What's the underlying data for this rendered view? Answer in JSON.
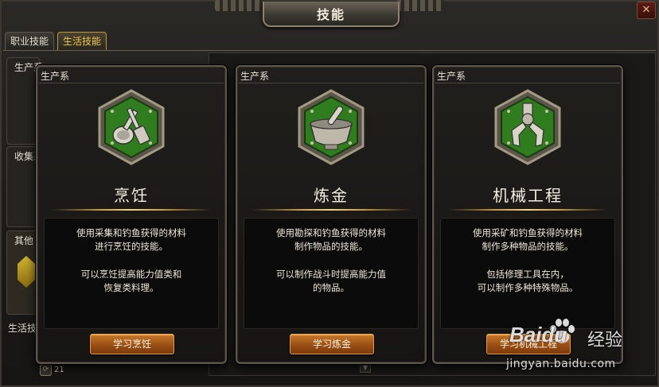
{
  "window": {
    "title": "技能",
    "close_glyph": "✕"
  },
  "tabs": [
    {
      "label": "职业技能",
      "active": false
    },
    {
      "label": "生活技能",
      "active": true
    }
  ],
  "background_panel": {
    "section_labels": [
      "生产系",
      "收集系",
      "其他",
      "生活技"
    ],
    "counter_value": "21",
    "scroll_down_glyph": "▼"
  },
  "cards": [
    {
      "header": "生产系",
      "icon": "cooking-utensils-icon",
      "title": "烹饪",
      "desc_line1": "使用采集和钓鱼获得的材料\n进行烹饪的技能。",
      "desc_line2": "可以烹饪提高能力值类和\n恢复类料理。",
      "button": "学习烹饪"
    },
    {
      "header": "生产系",
      "icon": "alchemy-mortar-icon",
      "title": "炼金",
      "desc_line1": "使用勘探和钓鱼获得的材料\n制作物品的技能。",
      "desc_line2": "可以制作战斗时提高能力值\n的物品。",
      "button": "学习炼金"
    },
    {
      "header": "生产系",
      "icon": "mechanical-claw-icon",
      "title": "机械工程",
      "desc_line1": "使用采矿和钓鱼获得的材料\n制作多种物品的技能。",
      "desc_line2": "包括修理工具在内，\n可以制作多种特殊物品。",
      "button": "学习机械工程"
    }
  ],
  "watermark": {
    "brand": "Baidu",
    "brand_cn": "经验",
    "url": "jingyan.baidu.com"
  },
  "colors": {
    "accent_gold": "#f0c64a",
    "button_orange": "#b5651d",
    "emblem_green": "#3f9a2a"
  }
}
